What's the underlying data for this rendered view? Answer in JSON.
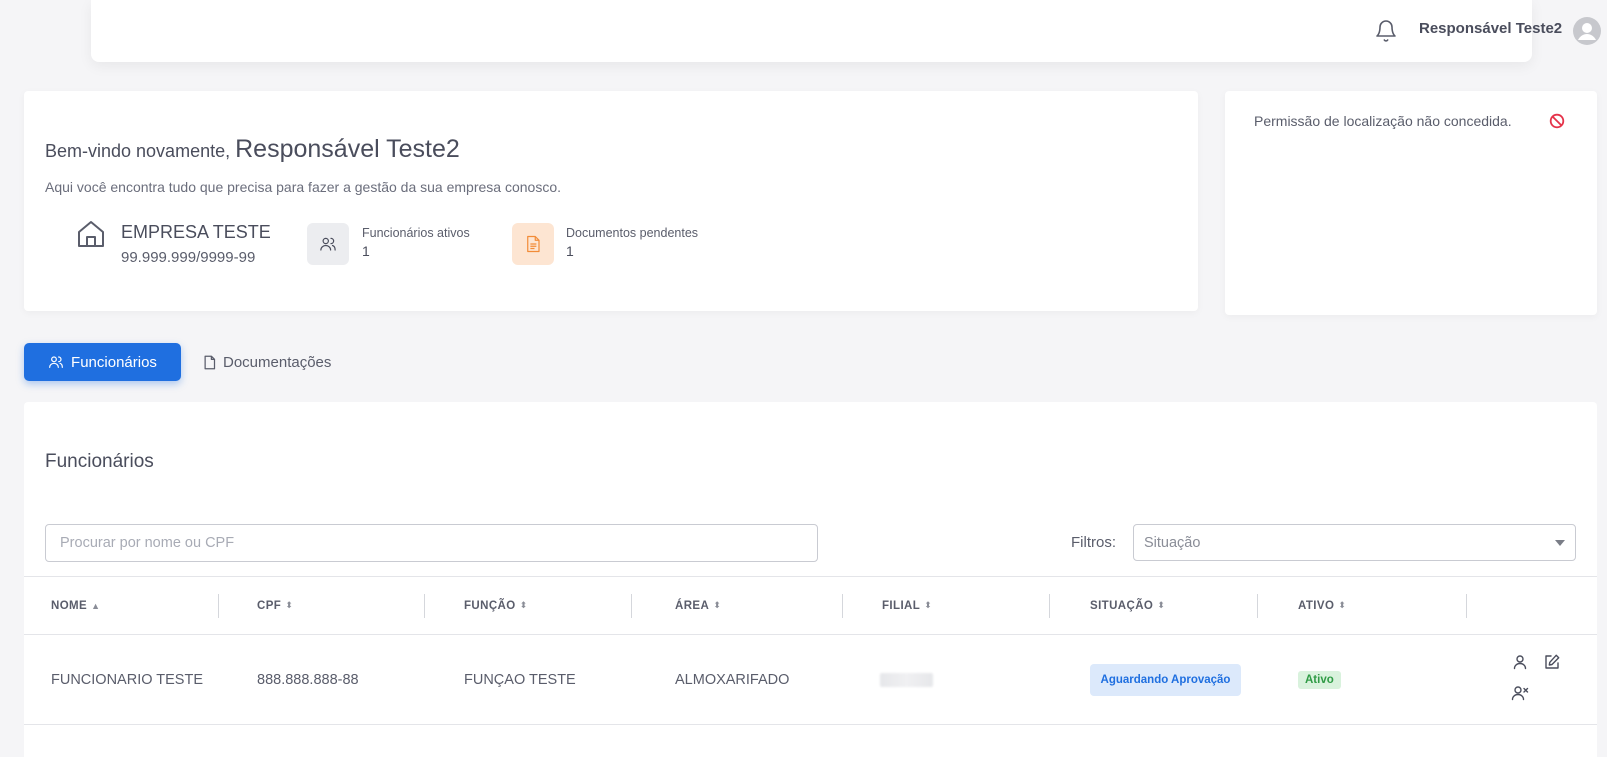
{
  "header": {
    "user_name": "Responsável Teste2"
  },
  "welcome": {
    "greeting_prefix": "Bem-vindo novamente,",
    "greeting_name": "Responsável Teste2",
    "subtitle": "Aqui você encontra tudo que precisa para fazer a gestão da sua empresa conosco.",
    "company_name": "EMPRESA TESTE",
    "company_cnpj": "99.999.999/9999-99",
    "stats": [
      {
        "label": "Funcionários ativos",
        "value": "1"
      },
      {
        "label": "Documentos pendentes",
        "value": "1"
      }
    ]
  },
  "location": {
    "message": "Permissão de localização não concedida."
  },
  "tabs": [
    {
      "label": "Funcionários",
      "active": true
    },
    {
      "label": "Documentações",
      "active": false
    }
  ],
  "main": {
    "title": "Funcionários",
    "search_placeholder": "Procurar por nome ou CPF",
    "filters_label": "Filtros:",
    "situation_placeholder": "Situação"
  },
  "table": {
    "columns": [
      "NOME",
      "CPF",
      "FUNÇÃO",
      "ÁREA",
      "FILIAL",
      "SITUAÇÃO",
      "ATIVO"
    ],
    "sort_icons": [
      "▲",
      "⬍",
      "⬍",
      "⬍",
      "⬍",
      "⬍",
      "⬍"
    ],
    "rows": [
      {
        "nome": "FUNCIONARIO TESTE",
        "cpf": "888.888.888-88",
        "funcao": "FUNÇAO TESTE",
        "area": "ALMOXARIFADO",
        "situacao": "Aguardando Aprovação",
        "ativo": "Ativo"
      }
    ]
  },
  "icons": {
    "notification": "bell-icon",
    "avatar": "user-circle-icon",
    "company": "home-icon",
    "employees": "users-icon",
    "documents": "document-icon",
    "denied": "no-entry-icon",
    "row_view": "user-icon",
    "row_edit": "edit-icon",
    "row_remove": "user-remove-icon"
  },
  "colors": {
    "primary": "#1f6fe0",
    "orange_icon": "#f28c38",
    "denied": "#e5334a",
    "badge_blue_bg": "#dce9fb",
    "badge_green_bg": "#d9f2dd",
    "badge_green_text": "#2f9b45"
  }
}
